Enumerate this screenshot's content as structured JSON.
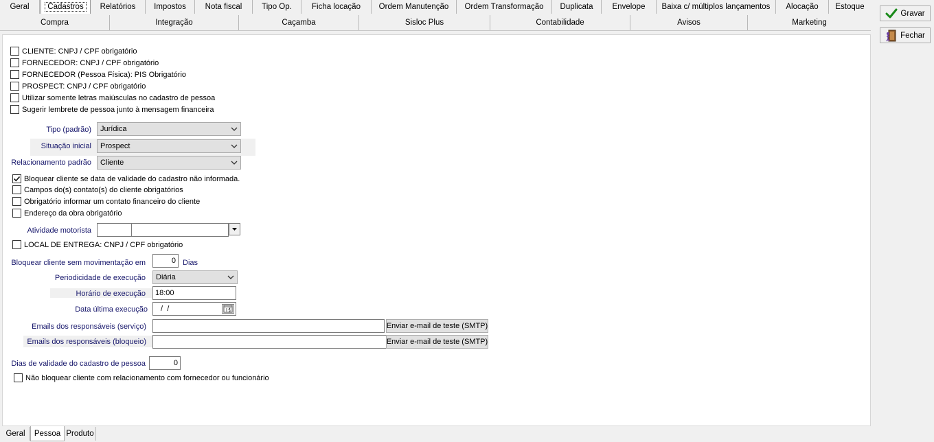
{
  "tabs_row1": [
    "Geral",
    "Cadastros",
    "Relatórios",
    "Impostos",
    "Nota fiscal",
    "Tipo Op.",
    "Ficha locação",
    "Ordem Manutenção",
    "Ordem Transformação",
    "Duplicata",
    "Envelope",
    "Baixa c/ múltiplos lançamentos",
    "Alocação",
    "Estoque"
  ],
  "tabs_row2": [
    "Compra",
    "Integração",
    "Caçamba",
    "Sisloc Plus",
    "Contabilidade",
    "Avisos",
    "Marketing"
  ],
  "active_tab": "Cadastros",
  "buttons": {
    "save": "Gravar",
    "close": "Fechar"
  },
  "checks_top": [
    {
      "label": "CLIENTE: CNPJ / CPF obrigatório",
      "checked": false
    },
    {
      "label": "FORNECEDOR: CNPJ / CPF obrigatório",
      "checked": false
    },
    {
      "label": "FORNECEDOR (Pessoa Física): PIS Obrigatório",
      "checked": false
    },
    {
      "label": "PROSPECT: CNPJ / CPF obrigatório",
      "checked": false
    },
    {
      "label": "Utilizar somente letras maiúsculas no cadastro de pessoa",
      "checked": false
    },
    {
      "label": "Sugerir lembrete de pessoa junto à mensagem financeira",
      "checked": false
    }
  ],
  "tipo": {
    "label": "Tipo (padrão)",
    "value": "Jurídica"
  },
  "situacao": {
    "label": "Situação inicial",
    "value": "Prospect"
  },
  "relacionamento": {
    "label": "Relacionamento padrão",
    "value": "Cliente"
  },
  "checks_mid": [
    {
      "label": "Bloquear cliente se data de validade do cadastro não informada.",
      "checked": true
    },
    {
      "label": "Campos do(s) contato(s) do cliente obrigatórios",
      "checked": false
    },
    {
      "label": "Obrigatório informar um contato financeiro do cliente",
      "checked": false
    },
    {
      "label": "Endereço da obra obrigatório",
      "checked": false
    }
  ],
  "atividade": {
    "label": "Atividade motorista",
    "code": "",
    "desc": ""
  },
  "local_entrega": {
    "label": "LOCAL DE ENTREGA: CNPJ / CPF obrigatório",
    "checked": false
  },
  "bloquear": {
    "label": "Bloquear cliente sem movimentação em",
    "value": "0",
    "unit": "Dias"
  },
  "periodicidade": {
    "label": "Periodicidade de execução",
    "value": "Diária"
  },
  "horario": {
    "label": "Horário de execução",
    "value": "18:00"
  },
  "data_ultima": {
    "label": "Data última execução",
    "value": " /  /"
  },
  "emails_servico": {
    "label": "Emails dos responsáveis (serviço)",
    "value": "",
    "button": "Enviar e-mail de teste (SMTP)"
  },
  "emails_bloqueio": {
    "label": "Emails dos responsáveis (bloqueio)",
    "value": "",
    "button": "Enviar e-mail de teste (SMTP)"
  },
  "dias_validade": {
    "label": "Dias de validade do cadastro de pessoa",
    "value": "0"
  },
  "nao_bloquear": {
    "label": "Não bloquear cliente com relacionamento com fornecedor ou funcionário",
    "checked": false
  },
  "bottom_tabs": [
    "Geral",
    "Pessoa",
    "Produto"
  ],
  "bottom_active": "Pessoa",
  "colors": {
    "label_blue": "#16166b",
    "check_green": "#1a8a1a"
  }
}
